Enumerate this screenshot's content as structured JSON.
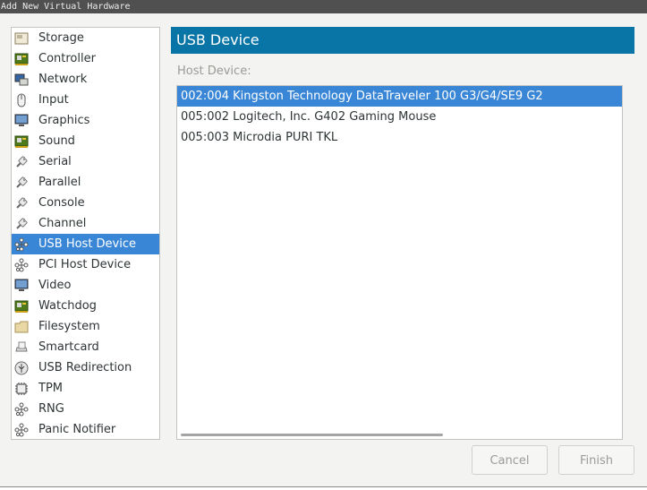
{
  "window": {
    "title": "Add New Virtual Hardware"
  },
  "sidebar": {
    "items": [
      {
        "label": "Storage",
        "icon": "storage-icon",
        "selected": false
      },
      {
        "label": "Controller",
        "icon": "controller-icon",
        "selected": false
      },
      {
        "label": "Network",
        "icon": "network-icon",
        "selected": false
      },
      {
        "label": "Input",
        "icon": "mouse-icon",
        "selected": false
      },
      {
        "label": "Graphics",
        "icon": "monitor-icon",
        "selected": false
      },
      {
        "label": "Sound",
        "icon": "sound-card-icon",
        "selected": false
      },
      {
        "label": "Serial",
        "icon": "serial-plug-icon",
        "selected": false
      },
      {
        "label": "Parallel",
        "icon": "parallel-plug-icon",
        "selected": false
      },
      {
        "label": "Console",
        "icon": "console-plug-icon",
        "selected": false
      },
      {
        "label": "Channel",
        "icon": "channel-plug-icon",
        "selected": false
      },
      {
        "label": "USB Host Device",
        "icon": "usb-device-icon",
        "selected": true
      },
      {
        "label": "PCI Host Device",
        "icon": "pci-device-icon",
        "selected": false
      },
      {
        "label": "Video",
        "icon": "video-monitor-icon",
        "selected": false
      },
      {
        "label": "Watchdog",
        "icon": "watchdog-card-icon",
        "selected": false
      },
      {
        "label": "Filesystem",
        "icon": "folder-icon",
        "selected": false
      },
      {
        "label": "Smartcard",
        "icon": "smartcard-reader-icon",
        "selected": false
      },
      {
        "label": "USB Redirection",
        "icon": "usb-redirection-icon",
        "selected": false
      },
      {
        "label": "TPM",
        "icon": "chip-icon",
        "selected": false
      },
      {
        "label": "RNG",
        "icon": "rng-device-icon",
        "selected": false
      },
      {
        "label": "Panic Notifier",
        "icon": "panic-notifier-icon",
        "selected": false
      }
    ]
  },
  "main": {
    "header": "USB Device",
    "host_device_label": "Host Device:",
    "devices": [
      {
        "label": "002:004 Kingston Technology DataTraveler 100 G3/G4/SE9 G2",
        "selected": true
      },
      {
        "label": "005:002 Logitech, Inc. G402 Gaming Mouse",
        "selected": false
      },
      {
        "label": "005:003 Microdia PURI TKL",
        "selected": false
      }
    ]
  },
  "buttons": {
    "cancel": "Cancel",
    "finish": "Finish"
  },
  "colors": {
    "accent": "#0975a6",
    "selection": "#3a86d6"
  }
}
